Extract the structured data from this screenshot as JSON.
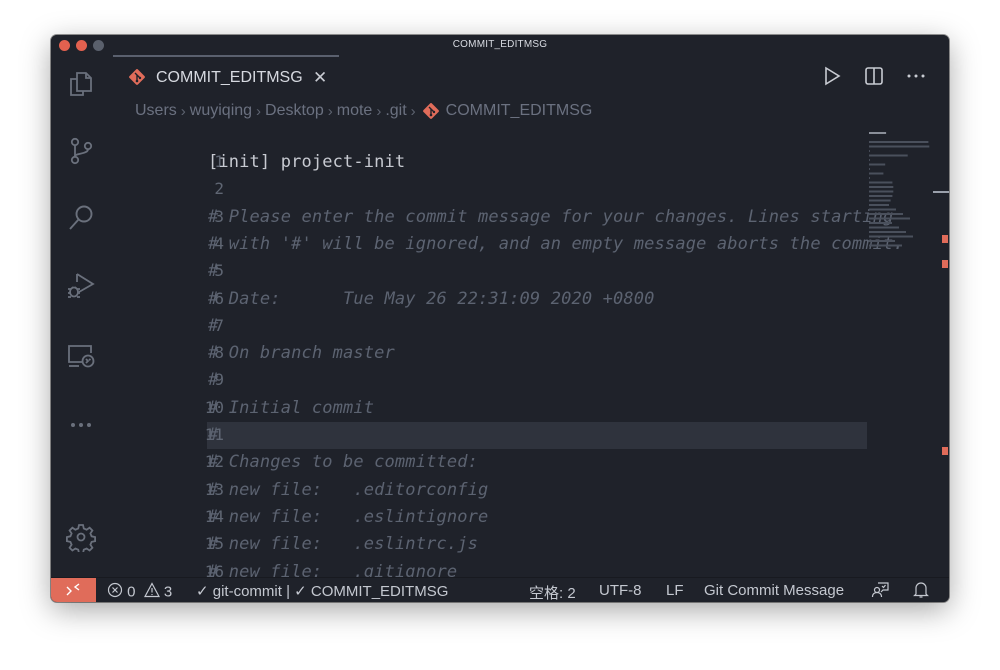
{
  "window": {
    "title": "COMMIT_EDITMSG"
  },
  "activity_bar": {
    "items": [
      {
        "name": "explorer",
        "icon": "files-icon"
      },
      {
        "name": "source-control",
        "icon": "source-control-icon"
      },
      {
        "name": "search",
        "icon": "search-icon"
      },
      {
        "name": "run-debug",
        "icon": "run-debug-icon"
      },
      {
        "name": "remote-explorer",
        "icon": "remote-explorer-icon"
      },
      {
        "name": "more",
        "icon": "ellipsis-icon"
      }
    ],
    "bottom": [
      {
        "name": "manage",
        "icon": "gear-icon"
      }
    ]
  },
  "tabs": [
    {
      "label": "COMMIT_EDITMSG",
      "icon": "git-icon",
      "active": true
    }
  ],
  "editor_actions": [
    {
      "name": "run",
      "icon": "play-icon"
    },
    {
      "name": "split-editor",
      "icon": "split-icon"
    },
    {
      "name": "more-actions",
      "icon": "ellipsis-icon"
    }
  ],
  "breadcrumb": [
    "Users",
    "wuyiqing",
    "Desktop",
    "mote",
    ".git",
    "COMMIT_EDITMSG"
  ],
  "editor": {
    "current_line": 11,
    "lines": [
      {
        "n": "1",
        "text": "[init] project-init",
        "kind": "normal"
      },
      {
        "n": "2",
        "text": "",
        "kind": "normal"
      },
      {
        "n": "3",
        "text": "# Please enter the commit message for your changes. Lines starting",
        "kind": "comment"
      },
      {
        "n": "4",
        "text": "# with '#' will be ignored, and an empty message aborts the commit.",
        "kind": "comment"
      },
      {
        "n": "5",
        "text": "#",
        "kind": "comment"
      },
      {
        "n": "6",
        "text": "# Date:      Tue May 26 22:31:09 2020 +0800",
        "kind": "comment"
      },
      {
        "n": "7",
        "text": "#",
        "kind": "comment"
      },
      {
        "n": "8",
        "text": "# On branch master",
        "kind": "comment"
      },
      {
        "n": "9",
        "text": "#",
        "kind": "comment"
      },
      {
        "n": "10",
        "text": "# Initial commit",
        "kind": "comment"
      },
      {
        "n": "11",
        "text": "#",
        "kind": "comment"
      },
      {
        "n": "12",
        "text": "# Changes to be committed:",
        "kind": "comment"
      },
      {
        "n": "13",
        "text": "# new file:   .editorconfig",
        "kind": "comment"
      },
      {
        "n": "14",
        "text": "# new file:   .eslintignore",
        "kind": "comment"
      },
      {
        "n": "15",
        "text": "# new file:   .eslintrc.js",
        "kind": "comment"
      },
      {
        "n": "16",
        "text": "# new file:   .gitignore",
        "kind": "comment"
      }
    ]
  },
  "status_bar": {
    "errors": "0",
    "warnings": "3",
    "language_status": "✓ git-commit | ✓ COMMIT_EDITMSG",
    "indent": "空格: 2",
    "encoding": "UTF-8",
    "eol": "LF",
    "language": "Git Commit Message"
  },
  "colors": {
    "accent": "#e06c5a",
    "background": "#1f222a",
    "comment": "#5c6371",
    "text": "#c7cad1"
  }
}
